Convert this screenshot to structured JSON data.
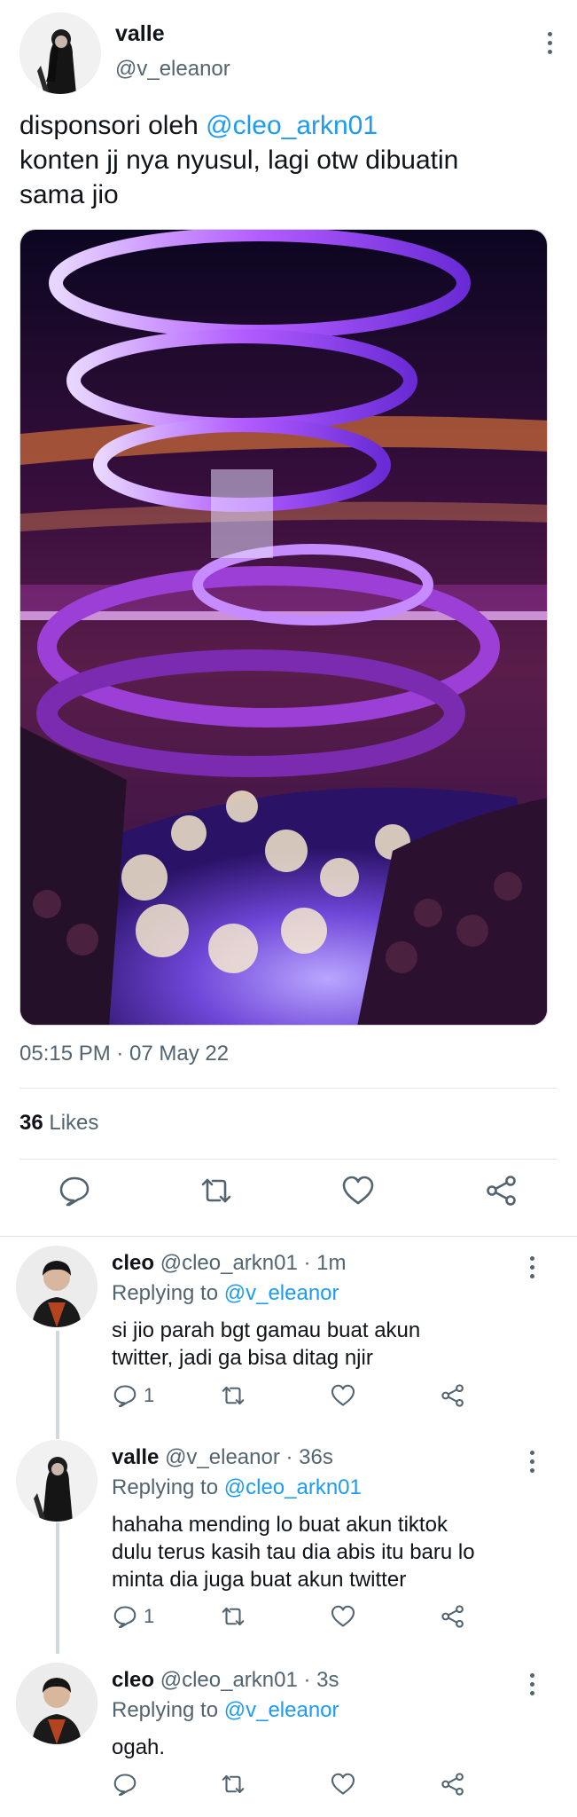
{
  "tweet": {
    "author_name": "valle",
    "author_handle": "@v_eleanor",
    "text_line1_prefix": "disponsori oleh ",
    "text_line1_mention": "@cleo_arkn01",
    "text_line2": "konten jj nya nyusul, lagi otw dibuatin",
    "text_line3": "sama jio",
    "timestamp": "05:15 PM · 07 May 22",
    "likes_count": "36",
    "likes_label": "Likes",
    "icons": {
      "more": "more-vertical-icon",
      "reply": "comment-icon",
      "retweet": "retweet-icon",
      "like": "heart-icon",
      "share": "share-icon"
    }
  },
  "replies": [
    {
      "name": "cleo",
      "handle": "@cleo_arkn01",
      "time": " · 1m",
      "replying_prefix": "Replying to ",
      "replying_to": "@v_eleanor",
      "lines": [
        "si jio parah bgt gamau buat akun",
        "twitter, jadi ga bisa ditag njir"
      ],
      "reply_count": "1"
    },
    {
      "name": "valle",
      "handle": "@v_eleanor",
      "time": " · 36s",
      "replying_prefix": "Replying to ",
      "replying_to": "@cleo_arkn01",
      "lines": [
        "hahaha mending lo buat akun tiktok",
        "dulu terus kasih tau dia abis itu baru lo",
        "minta dia juga buat akun twitter"
      ],
      "reply_count": "1"
    },
    {
      "name": "cleo",
      "handle": "@cleo_arkn01",
      "time": " · 3s",
      "replying_prefix": "Replying to ",
      "replying_to": "@v_eleanor",
      "lines": [
        "ogah."
      ],
      "reply_count": ""
    }
  ],
  "colors": {
    "accent": "#1d9bf0",
    "secondary_text": "#536471",
    "primary_text": "#0f1419",
    "divider": "#e3e6e8"
  }
}
